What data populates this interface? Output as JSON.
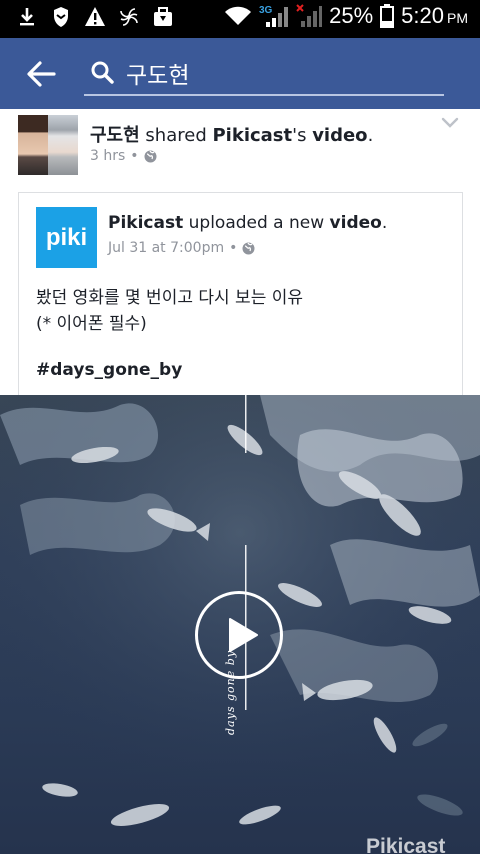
{
  "status_bar": {
    "icons": [
      "download-icon",
      "shield-icon",
      "warning-icon",
      "pinwheel-icon",
      "briefcase-icon"
    ],
    "network_label": "3G",
    "battery": "25%",
    "time": "5:20",
    "ampm": "PM"
  },
  "search": {
    "query": "구도현"
  },
  "post": {
    "author": "구도현",
    "action_word": "shared",
    "page_name": "Pikicast",
    "possessive": "'s",
    "object": "video",
    "period": ".",
    "time_ago": "3 hrs",
    "separator": "•",
    "privacy_icon": "globe-icon"
  },
  "shared": {
    "logo_text": "piki",
    "page": "Pikicast",
    "action": "uploaded a new",
    "object": "video",
    "period": ".",
    "date": "Jul 31 at 7:00pm",
    "separator": "•",
    "body_line1": "봤던 영화를 몇 번이고 다시 보는 이유",
    "body_line2": "(* 이어폰 필수)",
    "hashtag": "#days_gone_by"
  },
  "video": {
    "caption": "days gone by",
    "watermark": "Pikicast",
    "colors": {
      "water": "#2a3a55",
      "fish": "#d8dde3"
    }
  },
  "colors": {
    "header_bg": "#3b5998",
    "status_bg": "#000000",
    "piki_blue": "#1ba1e6",
    "text_primary": "#1d2129",
    "text_secondary": "#90949c"
  }
}
